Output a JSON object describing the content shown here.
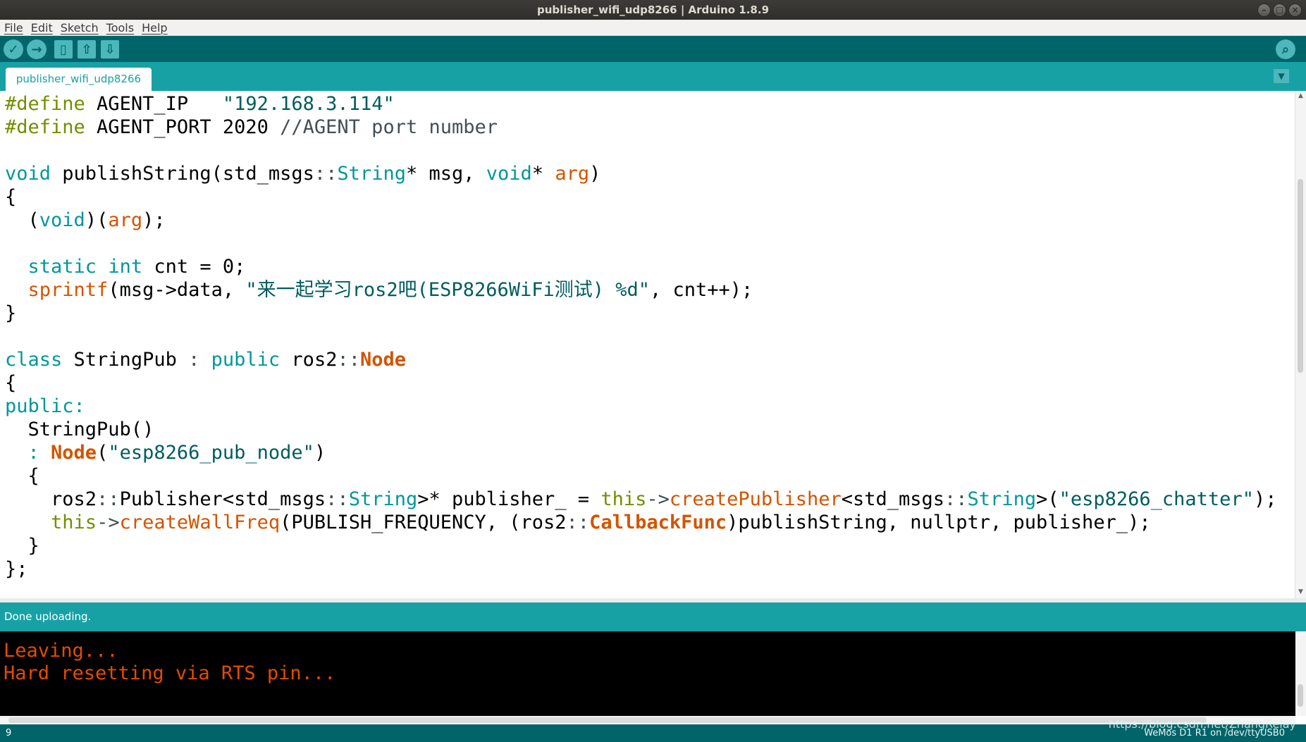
{
  "window": {
    "title": "publisher_wifi_udp8266 | Arduino 1.8.9"
  },
  "menu": [
    "File",
    "Edit",
    "Sketch",
    "Tools",
    "Help"
  ],
  "toolbar": {
    "verify": "✓",
    "upload": "→",
    "new": "▯",
    "open": "⇧",
    "save": "⇩",
    "serial_monitor": "⌕"
  },
  "tab": {
    "label": "publisher_wifi_udp8266",
    "menu_glyph": "▼"
  },
  "code": {
    "l1": {
      "a": "#define",
      "b": " AGENT_IP   ",
      "c": "\"192.168.3.114\""
    },
    "l2": {
      "a": "#define",
      "b": " AGENT_PORT 2020 ",
      "c": "//AGENT port number"
    },
    "l4": {
      "a": "void",
      "b": " publishString(std_msgs",
      "c": "::",
      "d": "String",
      "e": "* msg, ",
      "f": "void",
      "g": "* ",
      "h": "arg",
      "i": ")"
    },
    "l5": {
      "a": "{"
    },
    "l6": {
      "a": "  (",
      "b": "void",
      "c": ")(",
      "d": "arg",
      "e": ");"
    },
    "l8": {
      "a": "  ",
      "b": "static",
      "c": " ",
      "d": "int",
      "e": " cnt = 0;"
    },
    "l9": {
      "a": "  ",
      "b": "sprintf",
      "c": "(msg->data, ",
      "d": "\"来一起学习ros2吧(ESP8266WiFi测试) %d\"",
      "e": ", cnt++);"
    },
    "l10": {
      "a": "}"
    },
    "l12": {
      "a": "class",
      "b": " StringPub ",
      "c": ":",
      "d": " ",
      "e": "public",
      "f": " ros2",
      "g": "::",
      "h": "Node"
    },
    "l13": {
      "a": "{"
    },
    "l14": {
      "a": "public",
      "b": ":"
    },
    "l15": {
      "a": "  StringPub()"
    },
    "l16": {
      "a": "  : ",
      "b": "Node",
      "c": "(",
      "d": "\"esp8266_pub_node\"",
      "e": ")"
    },
    "l17": {
      "a": "  {"
    },
    "l18": {
      "a": "    ros2",
      "b": "::",
      "c": "Publisher<std_msgs",
      "d": "::",
      "e": "String",
      "f": ">* publisher_ = ",
      "g": "this",
      "h": "->",
      "i": "createPublisher",
      "j": "<std_msgs",
      "k": "::",
      "l": "String",
      "m": ">(",
      "n": "\"esp8266_chatter\"",
      "o": ");"
    },
    "l19": {
      "a": "    ",
      "b": "this",
      "c": "->",
      "d": "createWallFreq",
      "e": "(PUBLISH_FREQUENCY, (ros2",
      "f": "::",
      "g": "CallbackFunc",
      "h": ")publishString, nullptr, publisher_);"
    },
    "l20": {
      "a": "  }"
    },
    "l21": {
      "a": "};"
    }
  },
  "status": {
    "message": "Done uploading."
  },
  "console": {
    "lines": [
      "Leaving...",
      "Hard resetting via RTS pin..."
    ]
  },
  "bottom": {
    "line_number": "9",
    "board": "WeMos D1 R1 on /dev/ttyUSB0",
    "watermark": "https://blog.csdn.net/ZhangRelay"
  },
  "colors": {
    "teal_dark": "#006468",
    "teal": "#17a1a5",
    "console_text": "#e34c00"
  }
}
